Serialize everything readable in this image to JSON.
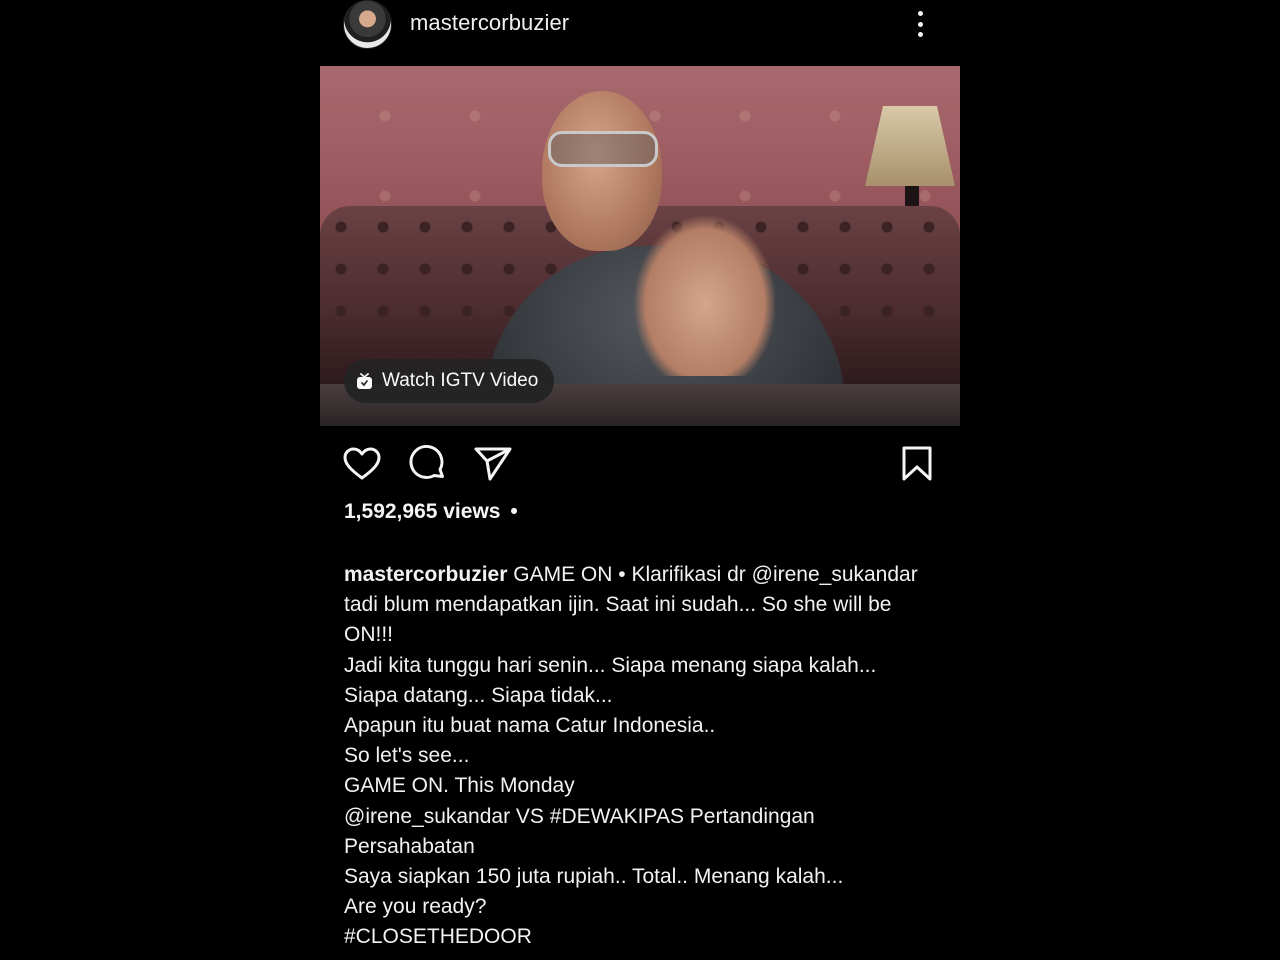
{
  "header": {
    "username": "mastercorbuzier",
    "more_icon": "more-vertical-icon"
  },
  "video": {
    "overlay_label": "Watch IGTV Video",
    "overlay_icon": "igtv-icon"
  },
  "actions": {
    "like_icon": "heart-icon",
    "comment_icon": "comment-icon",
    "share_icon": "send-icon",
    "save_icon": "bookmark-icon"
  },
  "stats": {
    "views": "1,592,965 views",
    "separator": "•"
  },
  "caption": {
    "username": "mastercorbuzier",
    "first_line_text": " GAME ON • Klarifikasi dr @irene_sukandar tadi blum mendapatkan ijin.  Saat ini sudah... So she will be ON!!!",
    "lines": [
      "Jadi kita tunggu hari senin... Siapa menang siapa kalah...",
      "Siapa datang... Siapa tidak...",
      "Apapun itu buat nama Catur Indonesia..",
      "So let's see...",
      "GAME ON. This Monday",
      "@irene_sukandar VS #DEWAKIPAS Pertandingan Persahabatan",
      "Saya siapkan 150 juta rupiah.. Total.. Menang kalah...",
      "Are you ready?",
      "#CLOSETHEDOOR"
    ]
  }
}
